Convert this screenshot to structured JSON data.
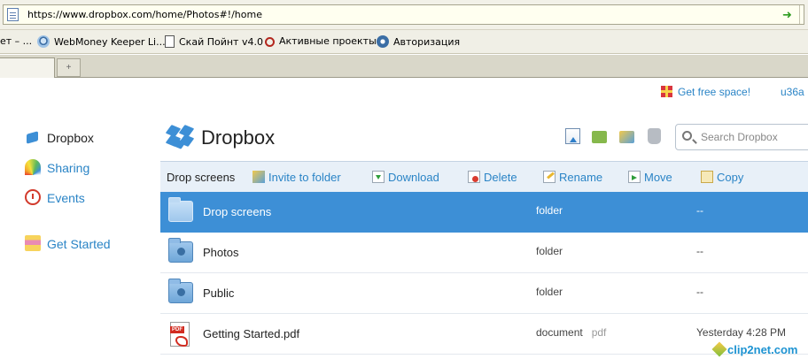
{
  "browser": {
    "url": "https://www.dropbox.com/home/Photos#!/home",
    "go_icon": "go-arrow-icon",
    "bookmarks": [
      {
        "label": "ет – ..."
      },
      {
        "label": "WebMoney Keeper Li..."
      },
      {
        "label": "Скай Пойнт v4.0"
      },
      {
        "label": "Активные проекты"
      },
      {
        "label": "Авторизация"
      }
    ],
    "new_tab_glyph": "+"
  },
  "header": {
    "free_space": "Get free space!",
    "user": "u36a",
    "title": "Dropbox",
    "search_placeholder": "Search Dropbox"
  },
  "sidebar": {
    "items": [
      {
        "label": "Dropbox",
        "icon": "dropbox-box-icon",
        "active": true
      },
      {
        "label": "Sharing",
        "icon": "rainbow-icon"
      },
      {
        "label": "Events",
        "icon": "clock-icon"
      },
      {
        "label": "Get Started",
        "icon": "cake-icon"
      }
    ]
  },
  "toolbar": {
    "icons": [
      "upload-icon",
      "new-folder-icon",
      "share-folder-icon",
      "show-deleted-icon"
    ]
  },
  "action_bar": {
    "selection": "Drop screens",
    "actions": [
      {
        "label": "Invite to folder",
        "icon": "invite-icon"
      },
      {
        "label": "Download",
        "icon": "download-icon"
      },
      {
        "label": "Delete",
        "icon": "delete-icon"
      },
      {
        "label": "Rename",
        "icon": "rename-icon"
      },
      {
        "label": "Move",
        "icon": "move-icon"
      },
      {
        "label": "Copy",
        "icon": "copy-icon"
      }
    ]
  },
  "files": [
    {
      "name": "Drop screens",
      "kind": "folder",
      "ext": "",
      "modified": "--",
      "selected": true,
      "icon": "folder-icon"
    },
    {
      "name": "Photos",
      "kind": "folder",
      "ext": "",
      "modified": "--",
      "selected": false,
      "icon": "photos-folder-icon"
    },
    {
      "name": "Public",
      "kind": "folder",
      "ext": "",
      "modified": "--",
      "selected": false,
      "icon": "public-folder-icon"
    },
    {
      "name": "Getting Started.pdf",
      "kind": "document",
      "ext": "pdf",
      "modified": "Yesterday 4:28 PM",
      "selected": false,
      "icon": "pdf-icon"
    }
  ],
  "watermark": "clip2net.com",
  "colors": {
    "accent": "#3d8fd6",
    "link": "#2a84c6",
    "action_bar_bg": "#e8f0f8"
  }
}
